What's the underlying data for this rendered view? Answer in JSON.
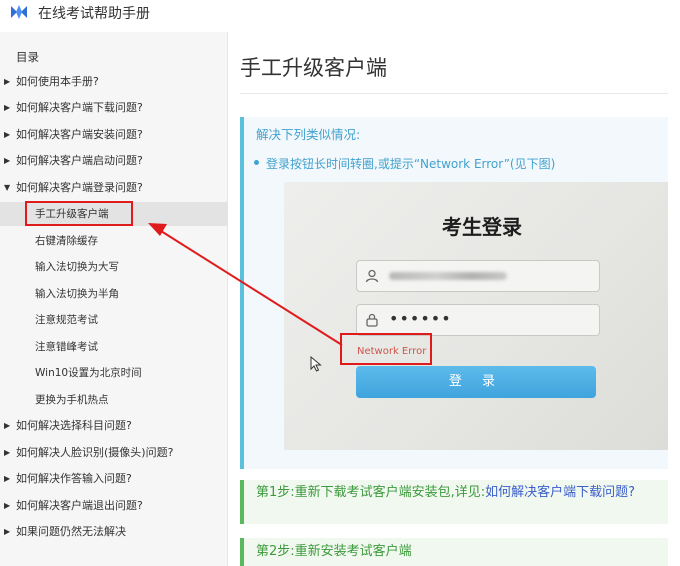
{
  "header": {
    "title": "在线考试帮助手册"
  },
  "sidebar": {
    "toc_label": "目录",
    "items": [
      {
        "label": "如何使用本手册?"
      },
      {
        "label": "如何解决客户端下载问题?"
      },
      {
        "label": "如何解决客户端安装问题?"
      },
      {
        "label": "如何解决客户端启动问题?"
      },
      {
        "label": "如何解决客户端登录问题?"
      }
    ],
    "sub_items": [
      {
        "label": "手工升级客户端"
      },
      {
        "label": "右键清除缓存"
      },
      {
        "label": "输入法切换为大写"
      },
      {
        "label": "输入法切换为半角"
      },
      {
        "label": "注意规范考试"
      },
      {
        "label": "注意错峰考试"
      },
      {
        "label": "Win10设置为北京时间"
      },
      {
        "label": "更换为手机热点"
      }
    ],
    "more_items": [
      {
        "label": "如何解决选择科目问题?"
      },
      {
        "label": "如何解决人脸识别(摄像头)问题?"
      },
      {
        "label": "如何解决作答输入问题?"
      },
      {
        "label": "如何解决客户端退出问题?"
      },
      {
        "label": "如果问题仍然无法解决"
      }
    ]
  },
  "content": {
    "title": "手工升级客户端",
    "callout": {
      "heading": "解决下列类似情况:",
      "bullet": "登录按钮长时间转圈,或提示“Network Error”(见下图)"
    },
    "screenshot": {
      "title": "考生登录",
      "password_mask": "••••••",
      "error_text": "Network Error",
      "login_button": "登 录"
    },
    "step1": {
      "prefix": "第1步:重新下载考试客户端安装包,详见:",
      "link": "如何解决客户端下载问题?"
    },
    "step2": {
      "text": "第2步:重新安装考试客户端"
    }
  },
  "colors": {
    "accent_blue": "#42a2cf",
    "accent_green": "#5cb85c",
    "annotation_red": "#e01b1b"
  }
}
